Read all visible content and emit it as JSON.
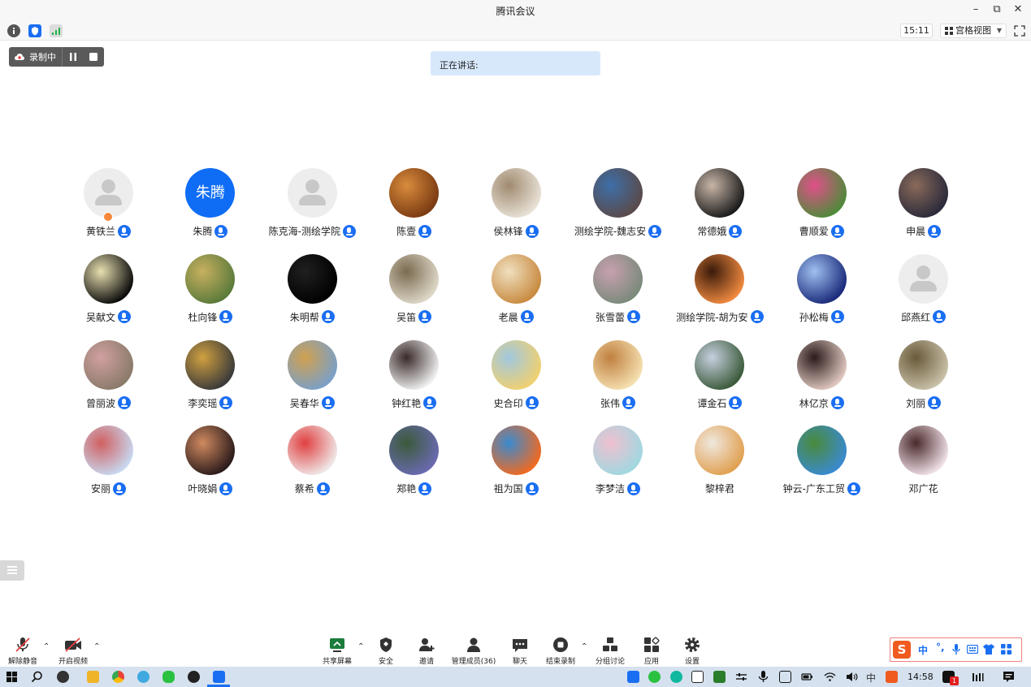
{
  "window": {
    "title": "腾讯会议"
  },
  "infobar": {
    "clock": "15:11",
    "view_label": "宫格视图"
  },
  "recording": {
    "status": "录制中"
  },
  "speaking": {
    "label": "正在讲话:"
  },
  "participants": [
    {
      "name": "黄铁兰",
      "avatar": "placeholder",
      "mic": true,
      "host": true
    },
    {
      "name": "朱腾",
      "avatar": "text",
      "avatar_text": "朱腾",
      "mic": true
    },
    {
      "name": "陈克海-测绘学院",
      "avatar": "placeholder",
      "mic": true
    },
    {
      "name": "陈壹",
      "avatar": "photo",
      "colors": [
        "#7a3a12",
        "#d98c3c"
      ],
      "mic": true
    },
    {
      "name": "侯林锋",
      "avatar": "photo",
      "colors": [
        "#e8e2d6",
        "#a08a70"
      ],
      "mic": true
    },
    {
      "name": "测绘学院-魏志安",
      "avatar": "photo",
      "colors": [
        "#5a4a4a",
        "#3d6fa8"
      ],
      "mic": true
    },
    {
      "name": "常德娥",
      "avatar": "photo",
      "colors": [
        "#1a1a1a",
        "#c9b6a8"
      ],
      "mic": true
    },
    {
      "name": "曹顺爱",
      "avatar": "photo",
      "colors": [
        "#4f8a3a",
        "#e0508a"
      ],
      "mic": true
    },
    {
      "name": "申晨",
      "avatar": "photo",
      "colors": [
        "#2a2a3a",
        "#8a6a5a"
      ],
      "mic": true
    },
    {
      "name": "吴献文",
      "avatar": "photo",
      "colors": [
        "#0a0a0a",
        "#e8e0b0"
      ],
      "mic": true
    },
    {
      "name": "杜向锋",
      "avatar": "photo",
      "colors": [
        "#5a7a3a",
        "#c8b060"
      ],
      "mic": true
    },
    {
      "name": "朱明帮",
      "avatar": "photo",
      "colors": [
        "#000000",
        "#202020"
      ],
      "mic": true
    },
    {
      "name": "吴笛",
      "avatar": "photo",
      "colors": [
        "#ded8c8",
        "#7a6a50"
      ],
      "mic": true
    },
    {
      "name": "老晨",
      "avatar": "photo",
      "colors": [
        "#c88a40",
        "#f0e0c0"
      ],
      "mic": true
    },
    {
      "name": "张雪蕾",
      "avatar": "photo",
      "colors": [
        "#7a8a7a",
        "#c8a0b0"
      ],
      "mic": true
    },
    {
      "name": "测绘学院-胡为安",
      "avatar": "photo",
      "colors": [
        "#f08a40",
        "#3a1a0a"
      ],
      "mic": true
    },
    {
      "name": "孙松梅",
      "avatar": "photo",
      "colors": [
        "#1a2a7a",
        "#a0c0f0"
      ],
      "mic": true
    },
    {
      "name": "邱燕红",
      "avatar": "placeholder",
      "mic": true
    },
    {
      "name": "曾丽波",
      "avatar": "photo",
      "colors": [
        "#8a7a6a",
        "#d0a0a0"
      ],
      "mic": true
    },
    {
      "name": "李奕瑶",
      "avatar": "photo",
      "colors": [
        "#3a3a3a",
        "#d0a040"
      ],
      "mic": true
    },
    {
      "name": "吴春华",
      "avatar": "photo",
      "colors": [
        "#7aa0c8",
        "#d0a050"
      ],
      "mic": true
    },
    {
      "name": "钟红艳",
      "avatar": "photo",
      "colors": [
        "#f0f0f0",
        "#3a2a2a"
      ],
      "mic": true
    },
    {
      "name": "史合印",
      "avatar": "photo",
      "colors": [
        "#f0d070",
        "#a0c8e0"
      ],
      "mic": true
    },
    {
      "name": "张伟",
      "avatar": "photo",
      "colors": [
        "#f5e0b0",
        "#c08040"
      ],
      "mic": true
    },
    {
      "name": "谭金石",
      "avatar": "photo",
      "colors": [
        "#3a5a3a",
        "#c8d0e0"
      ],
      "mic": true
    },
    {
      "name": "林亿京",
      "avatar": "photo",
      "colors": [
        "#e0c8c0",
        "#2a1a1a"
      ],
      "mic": true
    },
    {
      "name": "刘丽",
      "avatar": "photo",
      "colors": [
        "#c8c0a8",
        "#6a5a3a"
      ],
      "mic": true
    },
    {
      "name": "安丽",
      "avatar": "photo",
      "colors": [
        "#c8d8f0",
        "#d06060"
      ],
      "mic": true
    },
    {
      "name": "叶晓娟",
      "avatar": "photo",
      "colors": [
        "#2a1a1a",
        "#d08a60"
      ],
      "mic": true
    },
    {
      "name": "蔡希",
      "avatar": "photo",
      "colors": [
        "#f0e8e8",
        "#e04040"
      ],
      "mic": true
    },
    {
      "name": "郑艳",
      "avatar": "photo",
      "colors": [
        "#6a6ab0",
        "#3a5a3a"
      ],
      "mic": true
    },
    {
      "name": "祖为国",
      "avatar": "photo",
      "colors": [
        "#f06a20",
        "#3a8ad0"
      ],
      "mic": true
    },
    {
      "name": "李梦洁",
      "avatar": "photo",
      "colors": [
        "#a0d8e0",
        "#f0c0d0"
      ],
      "mic": true
    },
    {
      "name": "黎梓君",
      "avatar": "photo",
      "colors": [
        "#e0a050",
        "#f0e8e0"
      ],
      "mic": false
    },
    {
      "name": "钟云-广东工贸",
      "avatar": "photo",
      "colors": [
        "#3a8ad0",
        "#4a8a3a"
      ],
      "mic": true
    },
    {
      "name": "邓广花",
      "avatar": "photo",
      "colors": [
        "#f0e0e8",
        "#4a2a2a"
      ],
      "mic": false
    }
  ],
  "toolbar": {
    "unmute": "解除静音",
    "start_video": "开启视频",
    "share_screen": "共享屏幕",
    "security": "安全",
    "invite": "邀请",
    "manage_members": "管理成员(36)",
    "chat": "聊天",
    "end_recording": "结束录制",
    "breakout": "分组讨论",
    "apps": "应用",
    "settings": "设置"
  },
  "ime": {
    "lang": "中"
  },
  "taskbar": {
    "time": "14:58",
    "ime_lang": "中",
    "notification_count": "1"
  }
}
